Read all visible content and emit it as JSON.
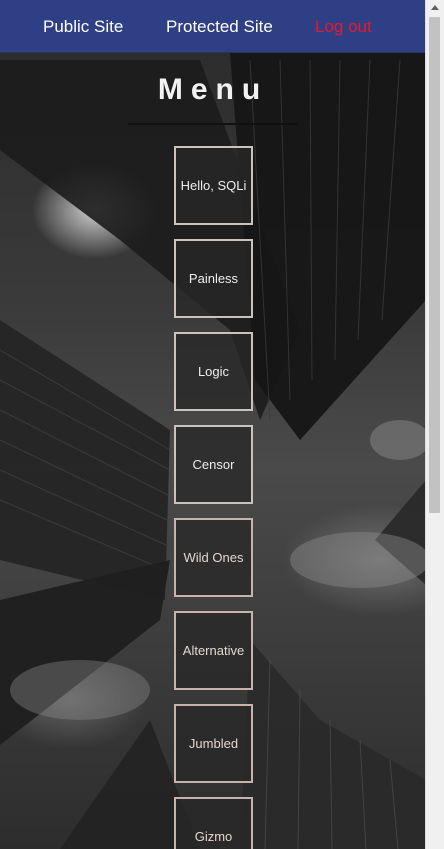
{
  "nav": {
    "public_site": "Public Site",
    "protected_site": "Protected Site",
    "log_out": "Log out"
  },
  "menu": {
    "title": "Menu",
    "items": [
      {
        "label": "Hello, SQLi"
      },
      {
        "label": "Painless"
      },
      {
        "label": "Logic"
      },
      {
        "label": "Censor"
      },
      {
        "label": "Wild Ones"
      },
      {
        "label": "Alternative"
      },
      {
        "label": "Jumbled"
      },
      {
        "label": "Gizmo"
      }
    ]
  },
  "colors": {
    "navbar": "#2f3f86",
    "logout": "#e8192c",
    "tile_border": "#c9c2bd"
  }
}
